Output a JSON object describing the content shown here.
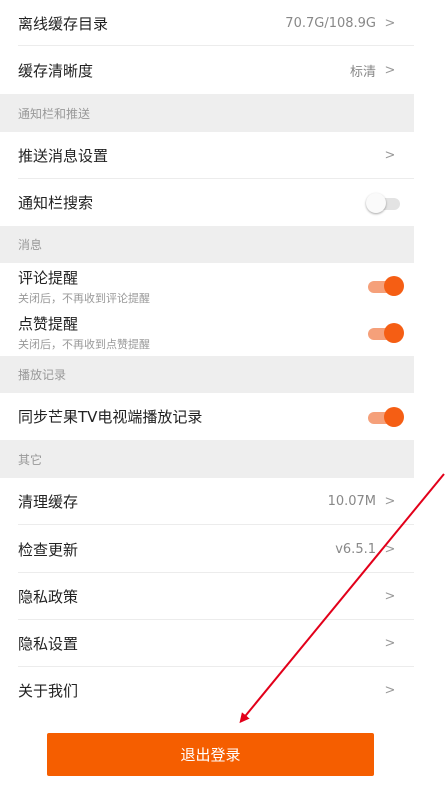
{
  "rows_top": [
    {
      "label": "离线缓存目录",
      "value": "70.7G/108.9G",
      "chevron": ">"
    },
    {
      "label": "缓存清晰度",
      "value": "标清",
      "chevron": ">"
    }
  ],
  "sections": {
    "notify": "通知栏和推送",
    "message": "消息",
    "history": "播放记录",
    "other": "其它"
  },
  "notify_rows": {
    "push_settings": {
      "label": "推送消息设置",
      "chevron": ">"
    },
    "bar_search": {
      "label": "通知栏搜索",
      "toggle": false
    }
  },
  "message_rows": {
    "comment": {
      "label": "评论提醒",
      "sub": "关闭后，不再收到评论提醒",
      "toggle": true
    },
    "like": {
      "label": "点赞提醒",
      "sub": "关闭后，不再收到点赞提醒",
      "toggle": true
    }
  },
  "history_rows": {
    "sync": {
      "label": "同步芒果TV电视端播放记录",
      "toggle": true
    }
  },
  "other_rows": {
    "clear_cache": {
      "label": "清理缓存",
      "value": "10.07M",
      "chevron": ">"
    },
    "check_update": {
      "label": "检查更新",
      "value": "v6.5.1",
      "chevron": ">"
    },
    "privacy_policy": {
      "label": "隐私政策",
      "chevron": ">"
    },
    "privacy_settings": {
      "label": "隐私设置",
      "chevron": ">"
    },
    "about": {
      "label": "关于我们",
      "chevron": ">"
    }
  },
  "logout_label": "退出登录",
  "colors": {
    "accent": "#f55e00",
    "toggle_on": "#f55e14",
    "section_bg": "#eeeeee",
    "annotation_arrow": "#e2001a"
  },
  "annotation": {
    "type": "arrow",
    "points_to": "logout-button"
  }
}
